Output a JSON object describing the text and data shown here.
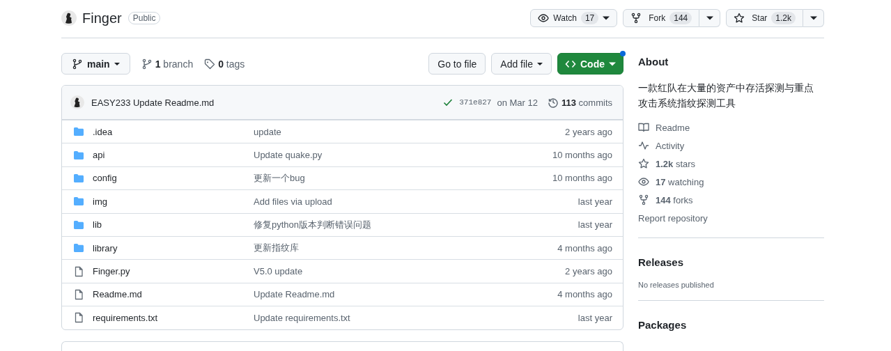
{
  "repo": {
    "name": "Finger",
    "visibility": "Public"
  },
  "actions": [
    {
      "kind": "watch",
      "label": "Watch",
      "count": "17"
    },
    {
      "kind": "fork",
      "label": "Fork",
      "count": "144"
    },
    {
      "kind": "star",
      "label": "Star",
      "count": "1.2k"
    }
  ],
  "branch_selector": {
    "label": "main"
  },
  "branch_count": "**1** branch",
  "tag_count": "**0** tags",
  "buttons": [
    {
      "kind": "plain",
      "label": "Go to file",
      "dropdown": false,
      "notification": false
    },
    {
      "kind": "plain",
      "label": "Add file",
      "dropdown": true,
      "notification": false
    },
    {
      "kind": "primary",
      "label": "Code",
      "dropdown": true,
      "notification": true
    }
  ],
  "latest_commit": {
    "author": "EASY233",
    "message": "Update Readme.md",
    "hash": "371e827",
    "date": "on Mar 12",
    "commits": "**113** commits"
  },
  "files": [
    {
      "kind": "folder",
      "name": ".idea",
      "message": "update",
      "time": "2 years ago"
    },
    {
      "kind": "folder",
      "name": "api",
      "message": "Update quake.py",
      "time": "10 months ago"
    },
    {
      "kind": "folder",
      "name": "config",
      "message": "更新一个bug",
      "time": "10 months ago"
    },
    {
      "kind": "folder",
      "name": "img",
      "message": "Add files via upload",
      "time": "last year"
    },
    {
      "kind": "folder",
      "name": "lib",
      "message": "修复python版本判断错误问题",
      "time": "last year"
    },
    {
      "kind": "folder",
      "name": "library",
      "message": "更新指纹库",
      "time": "4 months ago"
    },
    {
      "kind": "file",
      "name": "Finger.py",
      "message": "V5.0 update",
      "time": "2 years ago"
    },
    {
      "kind": "file",
      "name": "Readme.md",
      "message": "Update Readme.md",
      "time": "4 months ago"
    },
    {
      "kind": "file",
      "name": "requirements.txt",
      "message": "Update requirements.txt",
      "time": "last year"
    }
  ],
  "about": {
    "title": "About",
    "description": "一款红队在大量的资产中存活探测与重点攻击系统指纹探测工具",
    "links": [
      {
        "kind": "book",
        "text": "Readme"
      },
      {
        "kind": "pulse",
        "text": "Activity"
      },
      {
        "kind": "star",
        "text": "**1.2k** stars"
      },
      {
        "kind": "eye",
        "text": "**17** watching"
      },
      {
        "kind": "fork",
        "text": "**144** forks"
      },
      {
        "kind": "report",
        "text": "Report repository"
      }
    ]
  },
  "releases": {
    "title": "Releases",
    "note": "No releases published"
  },
  "packages": {
    "title": "Packages"
  }
}
